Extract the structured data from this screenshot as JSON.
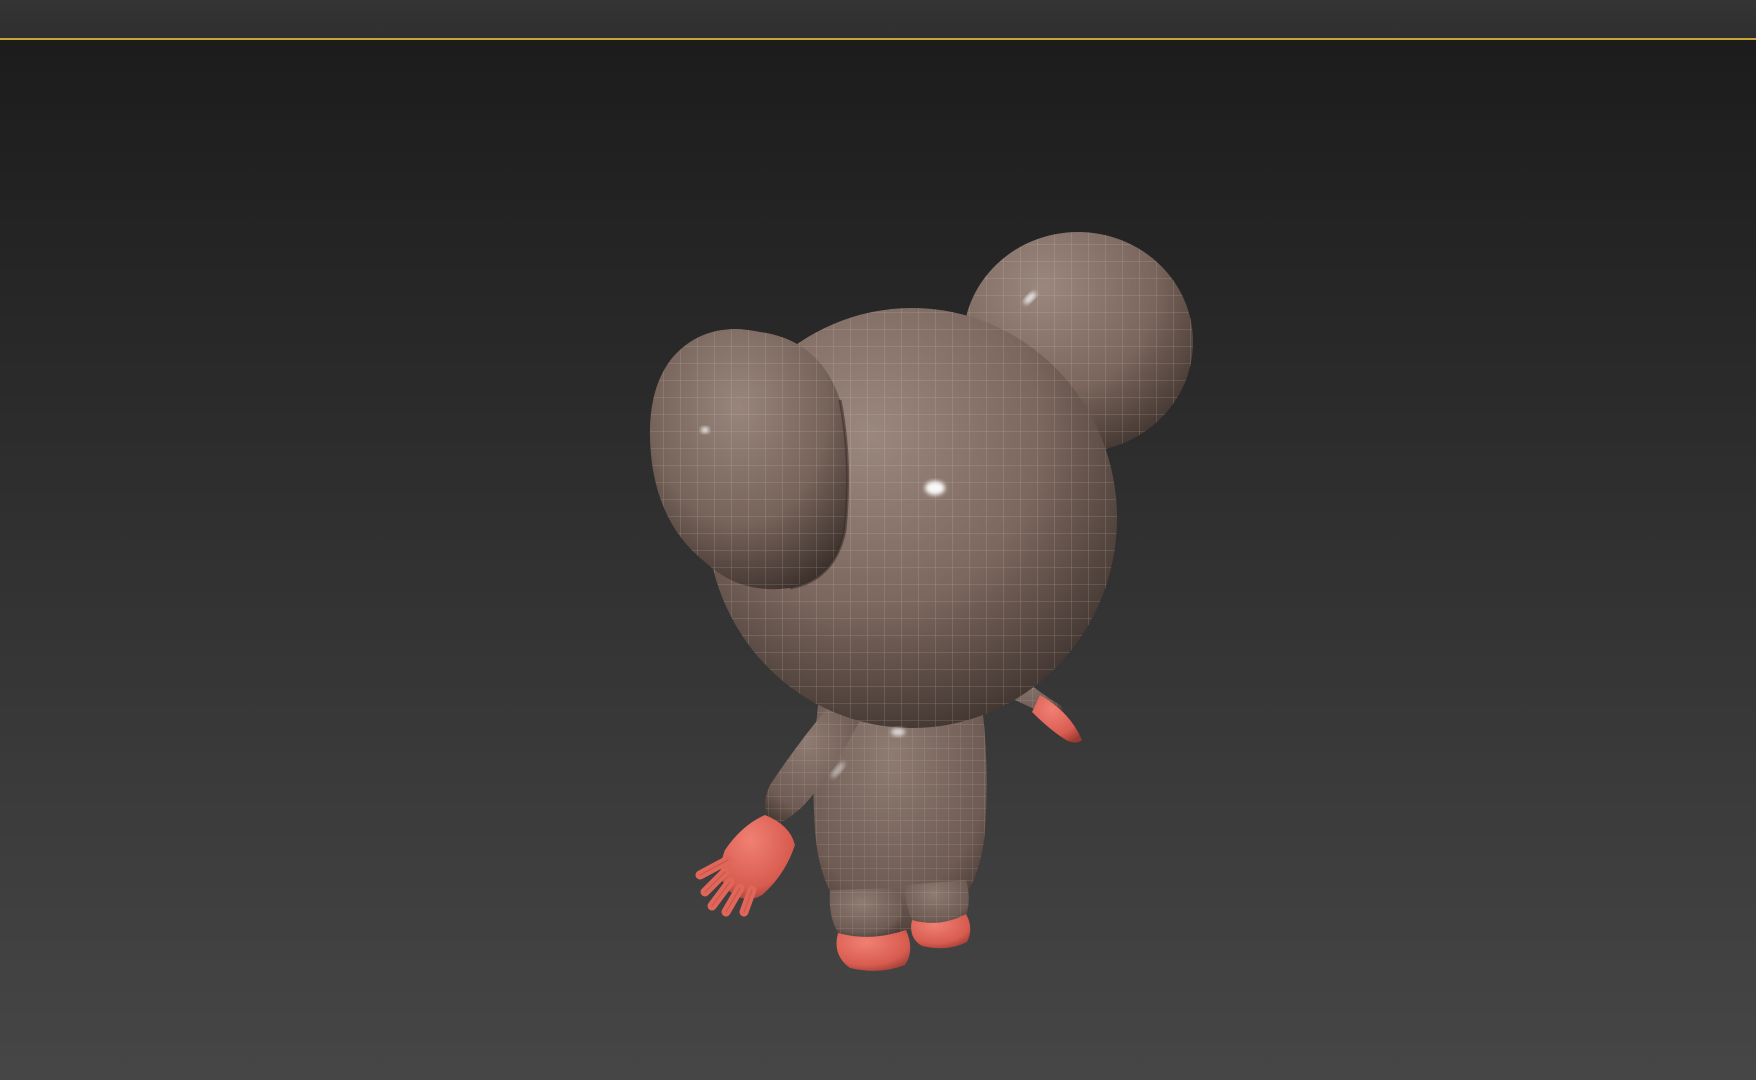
{
  "window": {
    "title": ""
  },
  "viewport": {
    "background_top": "#1c1c1c",
    "background_bottom": "#464646",
    "active_border_color": "#c9a63a",
    "model": {
      "name": "",
      "body_color": "#7e6a61",
      "hands_feet_color": "#e06457",
      "wireframe_color": "#d8d2cc"
    }
  }
}
